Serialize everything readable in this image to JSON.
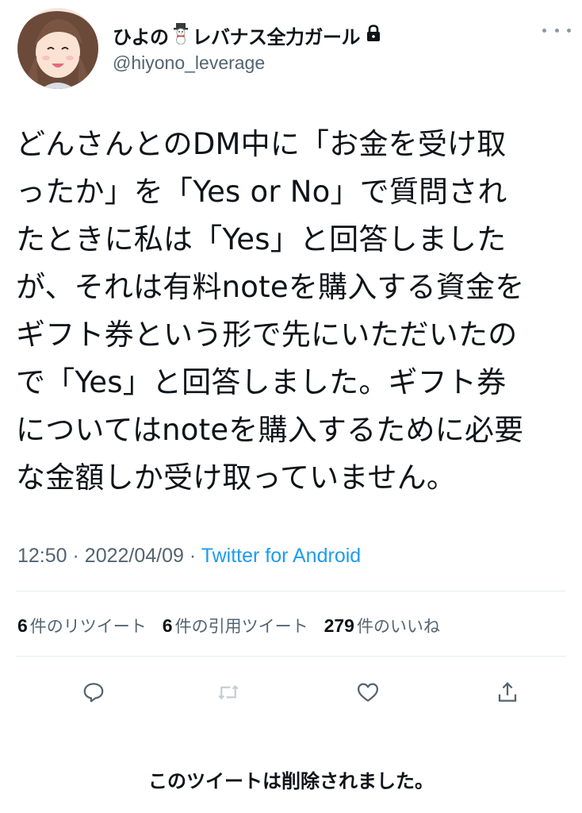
{
  "header": {
    "display_name_part1": "ひよの",
    "display_name_part2": "レバナス全力ガール",
    "handle": "@hiyono_leverage"
  },
  "tweet": {
    "text": "どんさんとのDM中に「お金を受け取\nったか」を「Yes or No」で質問され\nたときに私は「Yes」と回答しました\nが、それは有料noteを購入する資金を\nギフト券という形で先にいただいたの\nで「Yes」と回答しました。ギフト券\nについてはnoteを購入するために必要\nな金額しか受け取っていません。",
    "time": "12:50",
    "date": "2022/04/09",
    "separator": "·",
    "source": "Twitter for Android"
  },
  "stats": {
    "retweets_count": "6",
    "retweets_label": "件のリツイート",
    "quotes_count": "6",
    "quotes_label": "件の引用ツイート",
    "likes_count": "279",
    "likes_label": "件のいいね"
  },
  "actions": {
    "icons": [
      "reply-icon",
      "retweet-icon",
      "like-icon",
      "share-icon"
    ]
  },
  "footer": {
    "deleted_notice": "このツイートは削除されました。"
  },
  "colors": {
    "text": "#0f1419",
    "secondary": "#536471",
    "link": "#1d9bf0",
    "divider": "#e6ecf0",
    "disabled_icon": "#c4cfd6"
  }
}
